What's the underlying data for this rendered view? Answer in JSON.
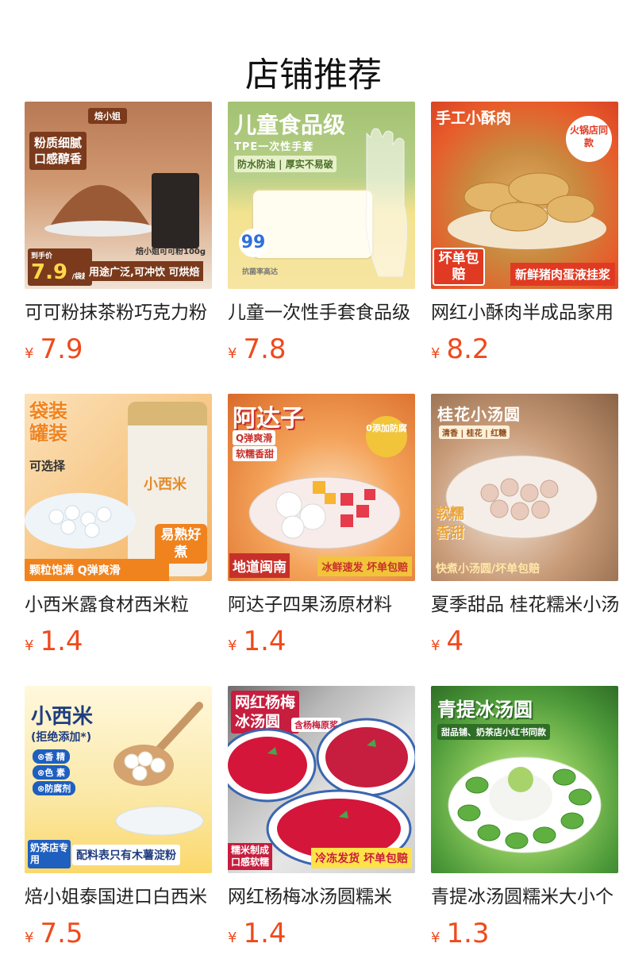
{
  "page": {
    "title": "店铺推荐"
  },
  "currency": "¥",
  "products": [
    {
      "name": "可可粉抹茶粉巧克力粉",
      "price": "7.9",
      "image": {
        "bg": "#a6663f",
        "accent": "#7a3a1b",
        "icon": "cocoa-powder-bowl",
        "texts": [
          "焙小姐",
          "粉质细腻",
          "口感醇香",
          "焙小姐可可粉100g",
          "到手价",
          "7.9",
          "/袋起",
          "用途广泛,可冲饮 可烘焙"
        ]
      }
    },
    {
      "name": "儿童一次性手套食品级",
      "price": "7.8",
      "image": {
        "bg": "#a8c474",
        "accent": "#f1d24c",
        "icon": "disposable-glove",
        "texts": [
          "儿童食品级",
          "TPE一次性手套",
          "防水防油 | 厚实不易破",
          "99",
          "抗菌率高达"
        ]
      }
    },
    {
      "name": "网红小酥肉半成品家用",
      "price": "8.2",
      "image": {
        "bg": "#e85b2a",
        "accent": "#c7302a",
        "icon": "fried-pork",
        "texts": [
          "手工小酥肉",
          "火锅店同款",
          "坏单包赔",
          "新鲜猪肉蛋液挂浆"
        ]
      }
    },
    {
      "name": "小西米露食材西米粒",
      "price": "1.4",
      "image": {
        "bg": "#f5b35a",
        "accent": "#f0831e",
        "icon": "sago-jar",
        "texts": [
          "袋装",
          "罐装",
          "可选择",
          "小西米",
          "易熟好煮",
          "颗粒饱满 Q弹爽滑"
        ]
      }
    },
    {
      "name": "阿达子四果汤原材料",
      "price": "1.4",
      "image": {
        "bg": "#f07a3a",
        "accent": "#f1c43a",
        "icon": "fruit-dessert-bowl",
        "texts": [
          "阿达子",
          "Q弹爽滑",
          "软糯香甜",
          "0添加防腐",
          "地道闽南",
          "冰鲜速发 坏单包赔"
        ]
      }
    },
    {
      "name": "夏季甜品 桂花糯米小汤圆",
      "price": "4",
      "image": {
        "bg": "#c9a47a",
        "accent": "#e9a53a",
        "icon": "osmanthus-dumplings",
        "texts": [
          "桂花小汤圆",
          "清香 | 桂花 | 红糖",
          "软糯",
          "香甜",
          "快煮小汤圆/坏单包赔"
        ]
      }
    },
    {
      "name": "焙小姐泰国进口白西米",
      "price": "7.5",
      "image": {
        "bg": "#fbd86b",
        "accent": "#1f5fbf",
        "icon": "sago-spoon",
        "texts": [
          "小西米",
          "(拒绝添加*)",
          "⊗香 精",
          "⊗色 素",
          "⊗防腐剂",
          "奶茶店专用",
          "配料表只有木薯淀粉"
        ]
      }
    },
    {
      "name": "网红杨梅冰汤圆糯米",
      "price": "1.4",
      "image": {
        "bg": "#c71d3e",
        "accent": "#e83a3a",
        "icon": "bayberry-bowl",
        "texts": [
          "网红杨梅",
          "冰汤圆",
          "含杨梅原浆",
          "糯米制成",
          "口感软糯",
          "冷冻发货 坏单包赔"
        ]
      }
    },
    {
      "name": "青提冰汤圆糯米大小个",
      "price": "1.3",
      "image": {
        "bg": "#4e9b3a",
        "accent": "#7cc24a",
        "icon": "green-grape-dumplings",
        "texts": [
          "青提冰汤圆",
          "甜品铺、奶茶店小红书同款"
        ]
      }
    }
  ],
  "colors": {
    "price": "#ef4a1c",
    "title": "#111111",
    "name": "#222222"
  }
}
